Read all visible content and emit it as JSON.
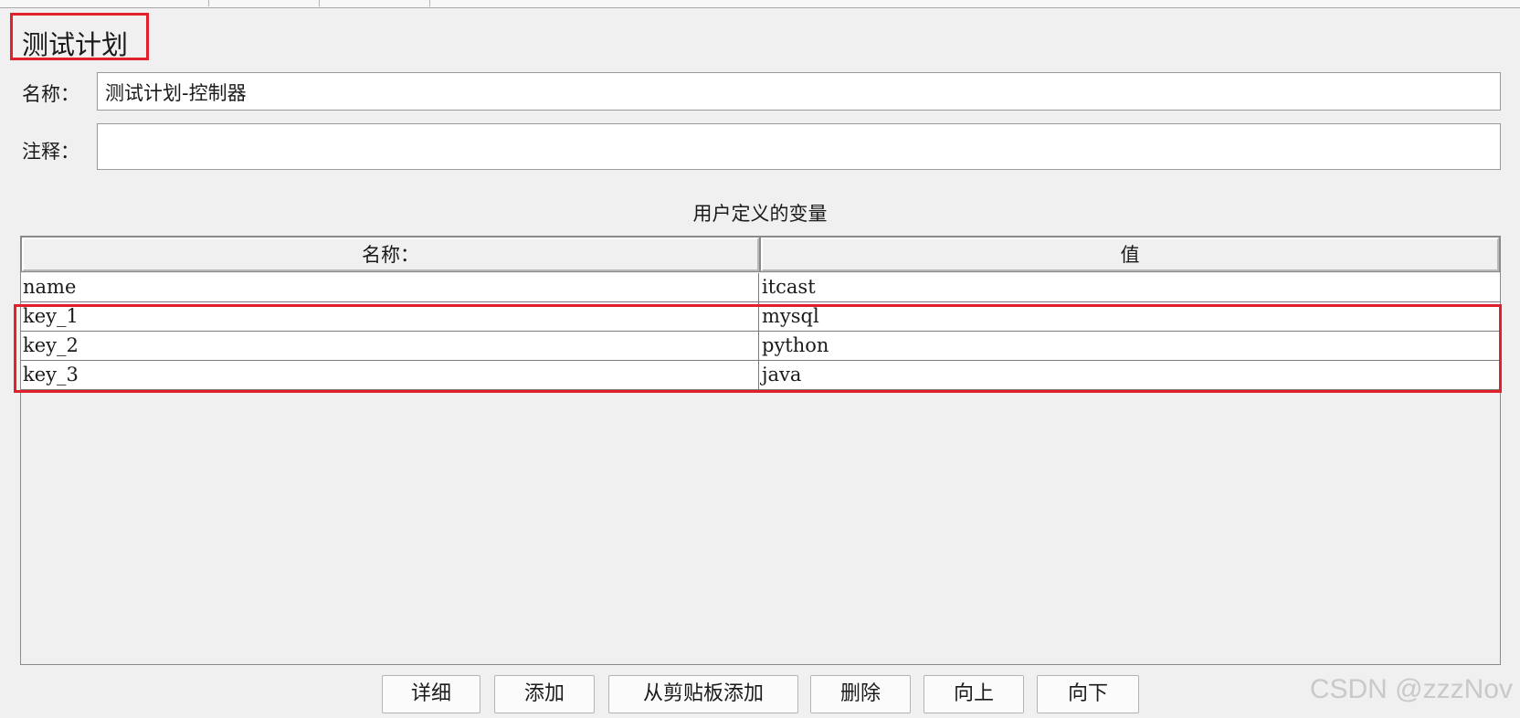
{
  "page_title": "测试计划",
  "form": {
    "name_label": "名称：",
    "name_value": "测试计划-控制器",
    "comment_label": "注释：",
    "comment_value": ""
  },
  "variables": {
    "section_title": "用户定义的变量",
    "columns": [
      "名称：",
      "值"
    ],
    "rows": [
      {
        "name": "name",
        "value": "itcast"
      },
      {
        "name": "key_1",
        "value": "mysql"
      },
      {
        "name": "key_2",
        "value": "python"
      },
      {
        "name": "key_3",
        "value": "java"
      }
    ],
    "highlighted_rows": [
      "key_1",
      "key_2",
      "key_3"
    ]
  },
  "buttons": {
    "detail": "详细",
    "add": "添加",
    "add_from_clipboard": "从剪贴板添加",
    "delete": "删除",
    "up": "向上",
    "down": "向下"
  },
  "watermark": "CSDN @zzzNov",
  "colors": {
    "highlight": "#e0202a",
    "background": "#f0f0f0"
  }
}
